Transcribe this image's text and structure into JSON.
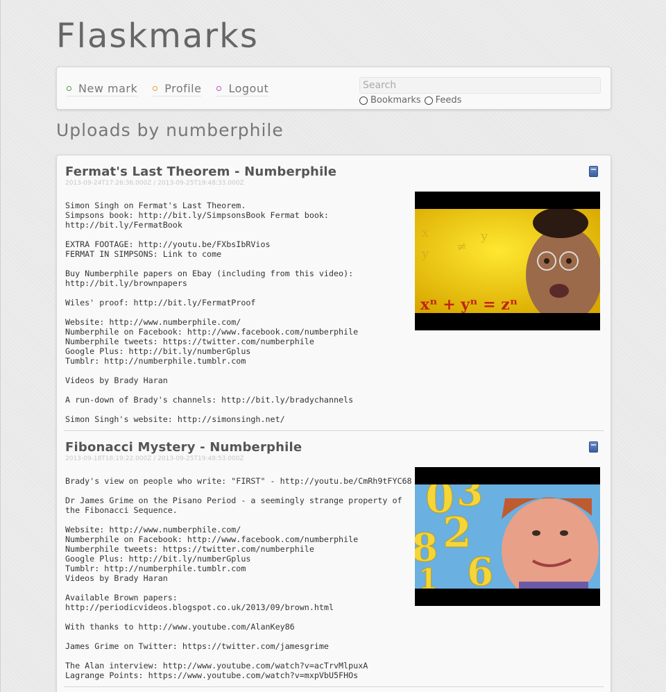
{
  "brand": "Flaskmarks",
  "nav": {
    "items": [
      {
        "label": "New mark",
        "color": "#4a9a3a"
      },
      {
        "label": "Profile",
        "color": "#e89a2a"
      },
      {
        "label": "Logout",
        "color": "#c04aba"
      }
    ]
  },
  "search": {
    "placeholder": "Search",
    "options": [
      "Bookmarks",
      "Feeds"
    ]
  },
  "page_title": "Uploads by numberphile",
  "marks": [
    {
      "title": "Fermat's Last Theorem - Numberphile",
      "dates": "2013-09-24T17:26:36.000Z / 2013-09-25T19:48:33.000Z",
      "description": "Simon Singh on Fermat's Last Theorem.\nSimpsons book: http://bit.ly/SimpsonsBook Fermat book:\nhttp://bit.ly/FermatBook\n\nEXTRA FOOTAGE: http://youtu.be/FXbsIbRVios\nFERMAT IN SIMPSONS: Link to come\n\nBuy Numberphile papers on Ebay (including from this video):\nhttp://bit.ly/brownpapers\n\nWiles' proof: http://bit.ly/FermatProof\n\nWebsite: http://www.numberphile.com/\nNumberphile on Facebook: http://www.facebook.com/numberphile\nNumberphile tweets: https://twitter.com/numberphile\nGoogle Plus: http://bit.ly/numberGplus\nTumblr: http://numberphile.tumblr.com\n\nVideos by Brady Haran\n\nA run-down of Brady's channels: http://bit.ly/bradychannels\n\nSimon Singh's website: http://simonsingh.net/",
      "thumb_text": "xⁿ + yⁿ = zⁿ"
    },
    {
      "title": "Fibonacci Mystery - Numberphile",
      "dates": "2013-09-18T18:19:22.000Z / 2013-09-25T19:48:53.000Z",
      "description": "Brady's view on people who write: \"FIRST\" - http://youtu.be/CmRh9tFYC68\n\nDr James Grime on the Pisano Period - a seemingly strange property of\nthe Fibonacci Sequence.\n\nWebsite: http://www.numberphile.com/\nNumberphile on Facebook: http://www.facebook.com/numberphile\nNumberphile tweets: https://twitter.com/numberphile\nGoogle Plus: http://bit.ly/numberGplus\nTumblr: http://numberphile.tumblr.com\nVideos by Brady Haran\n\nAvailable Brown papers:\nhttp://periodicvideos.blogspot.co.uk/2013/09/brown.html\n\nWith thanks to http://www.youtube.com/AlanKey86\n\nJames Grime on Twitter: https://twitter.com/jamesgrime\n\nThe Alan interview: http://www.youtube.com/watch?v=acTrvMlpuxA\nLagrange Points: https://www.youtube.com/watch?v=mxpVbU5FHOs"
    }
  ]
}
